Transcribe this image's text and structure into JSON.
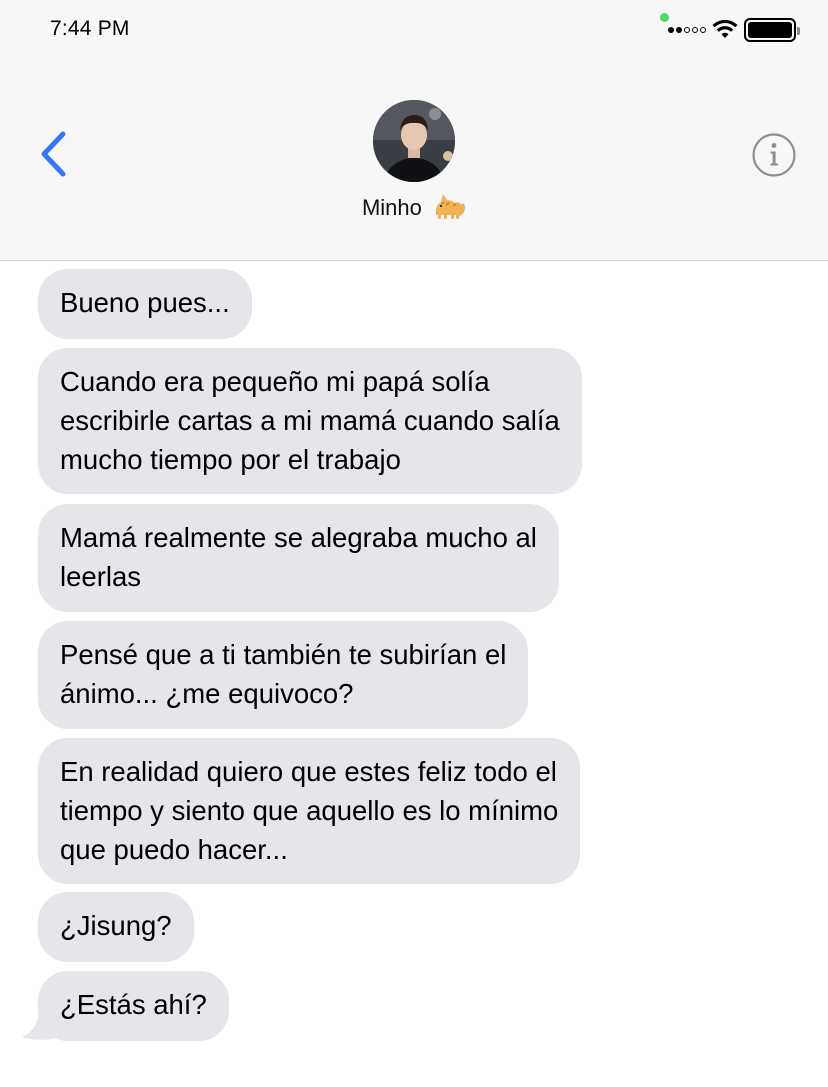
{
  "status_bar": {
    "time": "7:44 PM"
  },
  "header": {
    "contact_name": "Minho",
    "contact_emoji": "cat-emoji"
  },
  "icons": {
    "back": "chevron-left-icon",
    "info": "info-icon",
    "wifi": "wifi-icon",
    "battery": "battery-icon",
    "signal": "signal-dots-icon"
  },
  "colors": {
    "accent": "#3478f6",
    "bubble_received": "#e5e5ea",
    "header_bg": "#f7f7f7",
    "status_dot": "#4cd964"
  },
  "messages": [
    {
      "lines": [
        "Bueno pues..."
      ]
    },
    {
      "lines": [
        "Cuando era pequeño mi papá solía",
        "escribirle cartas a mi mamá cuando salía",
        "mucho tiempo por el trabajo"
      ]
    },
    {
      "lines": [
        "Mamá realmente se alegraba mucho al",
        "leerlas"
      ]
    },
    {
      "lines": [
        "Pensé que a ti también te subirían el",
        "ánimo... ¿me equivoco?"
      ]
    },
    {
      "lines": [
        "En realidad quiero que estes feliz todo el",
        "tiempo y siento que aquello es lo mínimo",
        "que puedo hacer..."
      ]
    },
    {
      "lines": [
        "¿Jisung?"
      ]
    },
    {
      "lines": [
        "¿Estás ahí?"
      ]
    }
  ]
}
